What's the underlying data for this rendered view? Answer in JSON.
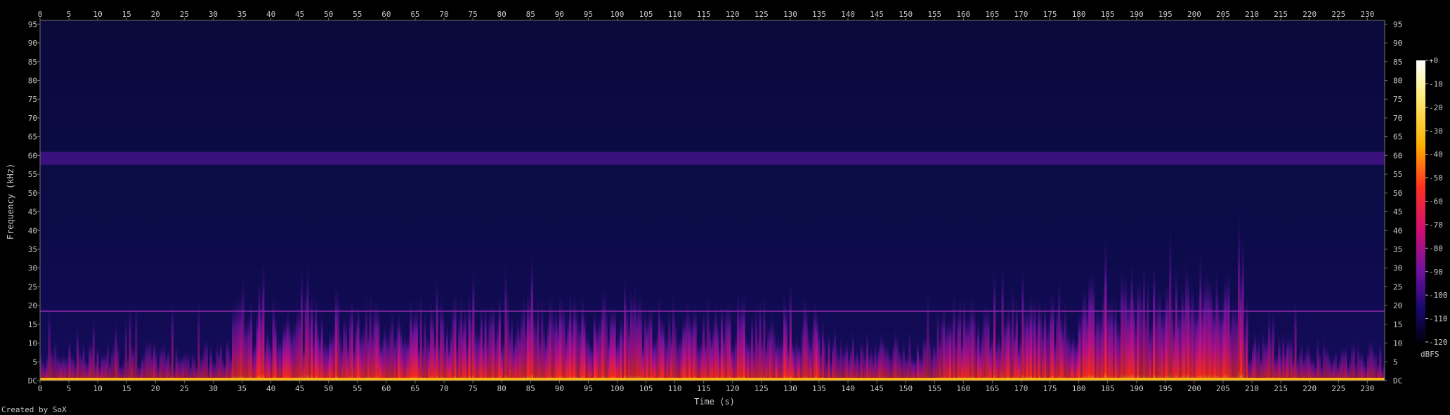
{
  "chart_data": {
    "type": "heatmap",
    "title": "",
    "xlabel": "Time (s)",
    "ylabel": "Frequency (kHz)",
    "xlim": [
      0,
      233
    ],
    "ylim": [
      0,
      96
    ],
    "x_ticks": [
      0,
      5,
      10,
      15,
      20,
      25,
      30,
      35,
      40,
      45,
      50,
      55,
      60,
      65,
      70,
      75,
      80,
      85,
      90,
      95,
      100,
      105,
      110,
      115,
      120,
      125,
      130,
      135,
      140,
      145,
      150,
      155,
      160,
      165,
      170,
      175,
      180,
      185,
      190,
      195,
      200,
      205,
      210,
      215,
      220,
      225,
      230
    ],
    "y_ticks": [
      "DC",
      "5",
      "10",
      "15",
      "20",
      "25",
      "30",
      "35",
      "40",
      "45",
      "50",
      "55",
      "60",
      "65",
      "70",
      "75",
      "80",
      "85",
      "90",
      "95"
    ],
    "y_tick_values": [
      0,
      5,
      10,
      15,
      20,
      25,
      30,
      35,
      40,
      45,
      50,
      55,
      60,
      65,
      70,
      75,
      80,
      85,
      90,
      95
    ],
    "colorbar": {
      "label": "dBFS",
      "ticks": [
        "+0",
        "-10",
        "-20",
        "-30",
        "-40",
        "-50",
        "-60",
        "-70",
        "-80",
        "-90",
        "-100",
        "-110",
        "-120"
      ],
      "range": [
        -120,
        0
      ]
    },
    "features": {
      "constant_band_khz": [
        57.5,
        61
      ],
      "horizontal_line_khz": 18.5,
      "quiet_intervals_s": [
        [
          0,
          32
        ],
        [
          218,
          233
        ]
      ],
      "loud_intervals_s": [
        [
          33,
          135
        ],
        [
          157,
          209
        ]
      ],
      "peak_interval_s": [
        180,
        208
      ]
    },
    "colors": {
      "background": "#000000",
      "noise_floor": "#0a0a3a",
      "band": "#3d1280",
      "energy_low": "#5a1a9a",
      "energy_mid": "#e02020",
      "energy_high": "#ffd020"
    }
  },
  "footer": {
    "credit": "Created by SoX"
  }
}
